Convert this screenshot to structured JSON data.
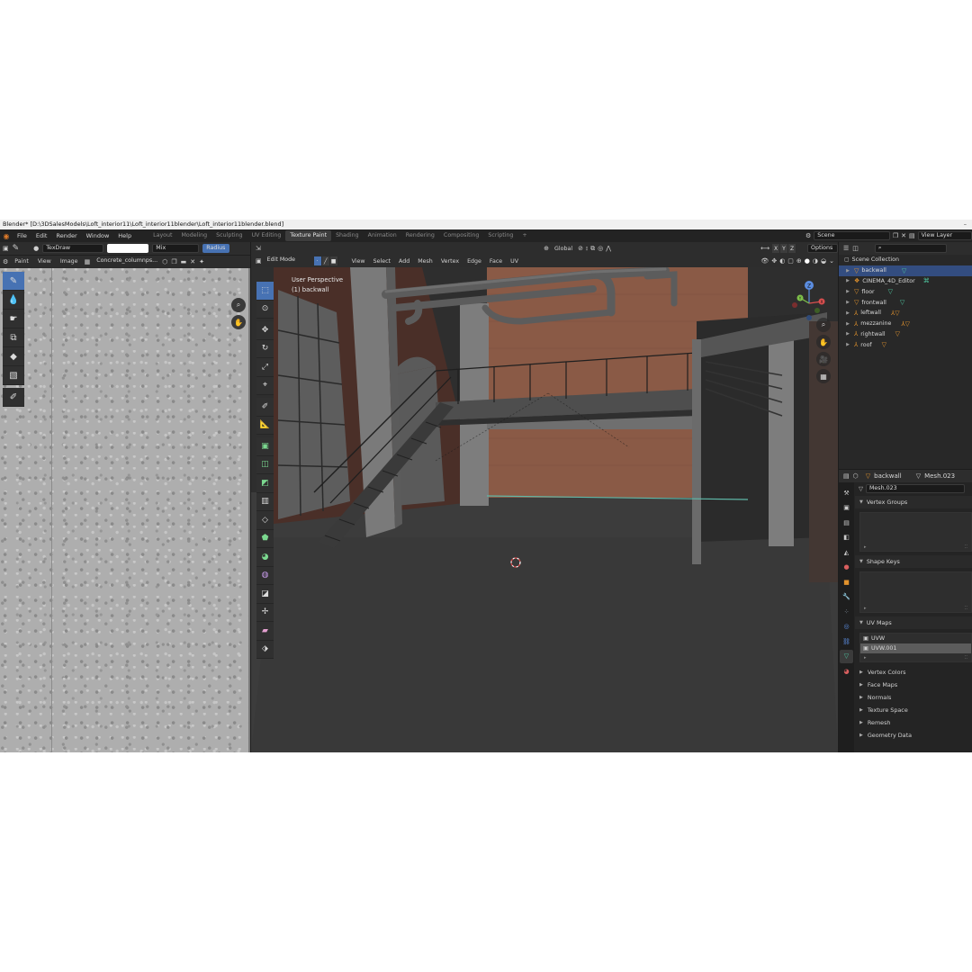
{
  "window": {
    "title": "Blender* [D:\\3DSalesModels\\Loft_interior11\\Loft_interior11blender\\Loft_interior11blender.blend]"
  },
  "menu": {
    "items": [
      "File",
      "Edit",
      "Render",
      "Window",
      "Help"
    ],
    "workspaces": [
      "Layout",
      "Modeling",
      "Sculpting",
      "UV Editing",
      "Texture Paint",
      "Shading",
      "Animation",
      "Rendering",
      "Compositing",
      "Scripting"
    ],
    "active_workspace": "Texture Paint",
    "add_tab": "+",
    "scene": "Scene",
    "view_layer": "View Layer"
  },
  "image_editor": {
    "brush": "TexDraw",
    "blend": "Mix",
    "radius_label": "Radius",
    "mode": "Paint",
    "view_menu": "View",
    "image_menu": "Image",
    "image_name": "Concrete_columnps..."
  },
  "viewport": {
    "mode": "Edit Mode",
    "menus": [
      "View",
      "Select",
      "Add",
      "Mesh",
      "Vertex",
      "Edge",
      "Face",
      "UV"
    ],
    "orientation": "Global",
    "options": "Options",
    "overlay_title": "User Perspective",
    "overlay_object": "(1) backwall",
    "gizmo": {
      "x": "X",
      "y": "Y",
      "z": "Z"
    },
    "xyz_toggles": [
      "X",
      "Y",
      "Z"
    ]
  },
  "outliner": {
    "root": "Scene Collection",
    "items": [
      {
        "name": "backwall",
        "selected": true
      },
      {
        "name": "CINEMA_4D_Editor",
        "selected": false
      },
      {
        "name": "floor",
        "selected": false
      },
      {
        "name": "frontwall",
        "selected": false
      },
      {
        "name": "leftwall",
        "selected": false
      },
      {
        "name": "mezzanine",
        "selected": false
      },
      {
        "name": "rightwall",
        "selected": false
      },
      {
        "name": "roof",
        "selected": false
      }
    ]
  },
  "properties": {
    "object": "backwall",
    "mesh": "Mesh.023",
    "data_name": "Mesh.023",
    "sections": {
      "vertex_groups": "Vertex Groups",
      "shape_keys": "Shape Keys",
      "uv_maps": "UV Maps",
      "vertex_colors": "Vertex Colors",
      "face_maps": "Face Maps",
      "normals": "Normals",
      "texture_space": "Texture Space",
      "remesh": "Remesh",
      "geometry_data": "Geometry Data"
    },
    "uv_maps": [
      {
        "name": "UVW",
        "selected": false
      },
      {
        "name": "UVW.001",
        "selected": true
      }
    ]
  },
  "colors": {
    "accent": "#4772b3",
    "selection": "#334d80",
    "mesh_orange": "#e2932d",
    "modifier_green": "#4fc6a0"
  }
}
